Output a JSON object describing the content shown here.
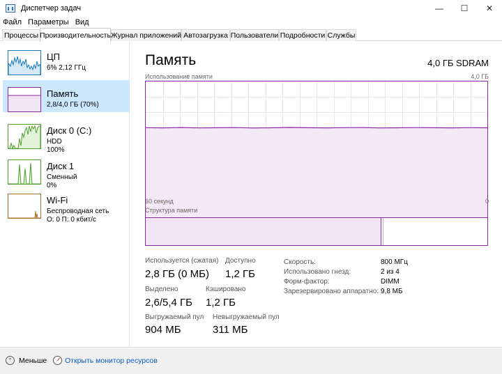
{
  "window": {
    "title": "Диспетчер задач",
    "minimize": "—",
    "maximize": "☐",
    "close": "✕"
  },
  "menu": [
    "Файл",
    "Параметры",
    "Вид"
  ],
  "tabs": [
    "Процессы",
    "Производительность",
    "Журнал приложений",
    "Автозагрузка",
    "Пользователи",
    "Подробности",
    "Службы"
  ],
  "active_tab": "Производительность",
  "sidebar": {
    "items": [
      {
        "name": "ЦП",
        "line2": "6%  2,12 ГГц",
        "line3": "",
        "color": "#1779ba"
      },
      {
        "name": "Память",
        "line2": "2,8/4,0 ГБ (70%)",
        "line3": "",
        "color": "#8b27a3"
      },
      {
        "name": "Диск 0 (C:)",
        "line2": "HDD",
        "line3": "100%",
        "color": "#4da02c"
      },
      {
        "name": "Диск 1",
        "line2": "Сменный",
        "line3": "0%",
        "color": "#4da02c"
      },
      {
        "name": "Wi-Fi",
        "line2": "Беспроводная сеть",
        "line3": "О: 0 П: 0 кбит/с",
        "color": "#a7702a"
      }
    ]
  },
  "memory": {
    "title": "Память",
    "spec": "4,0 ГБ SDRAM",
    "usage_label": "Использование памяти",
    "usage_max": "4,0 ГБ",
    "time_left": "60 секунд",
    "time_right": "0",
    "composition_label": "Структура памяти",
    "in_use_fraction": 0.7,
    "composition_in_use_fraction": 0.7,
    "stats": {
      "in_use_label": "Используется (сжатая)",
      "in_use_value": "2,8 ГБ (0 МБ)",
      "available_label": "Доступно",
      "available_value": "1,2 ГБ",
      "committed_label": "Выделено",
      "committed_value": "2,6/5,4 ГБ",
      "cached_label": "Кэшировано",
      "cached_value": "1,2 ГБ",
      "paged_label": "Выгружаемый пул",
      "paged_value": "904 МБ",
      "nonpaged_label": "Невыгружаемый пул",
      "nonpaged_value": "311 МБ"
    },
    "details": [
      {
        "label": "Скорость:",
        "value": "800 МГц"
      },
      {
        "label": "Использовано гнезд:",
        "value": "2 из 4"
      },
      {
        "label": "Форм-фактор:",
        "value": "DIMM"
      },
      {
        "label": "Зарезервировано аппаратно:",
        "value": "9,8 МБ"
      }
    ]
  },
  "footer": {
    "fewer": "Меньше",
    "monitor": "Открыть монитор ресурсов"
  },
  "colors": {
    "memory": "#8b27a3",
    "selected": "#cce8ff"
  }
}
